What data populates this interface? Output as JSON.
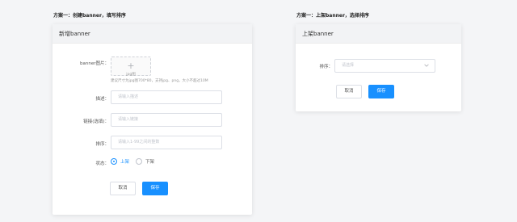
{
  "left": {
    "section_title": "方案一：创建banner，填写排序",
    "card_title": "新增banner",
    "form": {
      "image_label": "banner图片：",
      "upload_text": "jpg图",
      "upload_hint": "建议尺寸为jpg图700*80，支持jpg、png，大小不超过10M",
      "desc_label": "描述：",
      "desc_placeholder": "请输入描述",
      "link_label": "链接(选填)：",
      "link_placeholder": "请输入链接",
      "order_label": "排序：",
      "order_placeholder": "请输入1-99之间的整数",
      "status_label": "状态：",
      "status_options": [
        "上架",
        "下架"
      ],
      "status_selected": "上架"
    },
    "cancel_label": "取消",
    "save_label": "保存"
  },
  "right": {
    "section_title": "方案一：上架banner，选择排序",
    "card_title": "上架banner",
    "order_label": "排序：",
    "order_placeholder": "请选择",
    "cancel_label": "取消",
    "save_label": "保存"
  },
  "colors": {
    "primary": "#1890ff",
    "background": "#f4f5f7"
  },
  "icons": {
    "upload": "plus-icon",
    "select": "chevron-down-icon"
  }
}
